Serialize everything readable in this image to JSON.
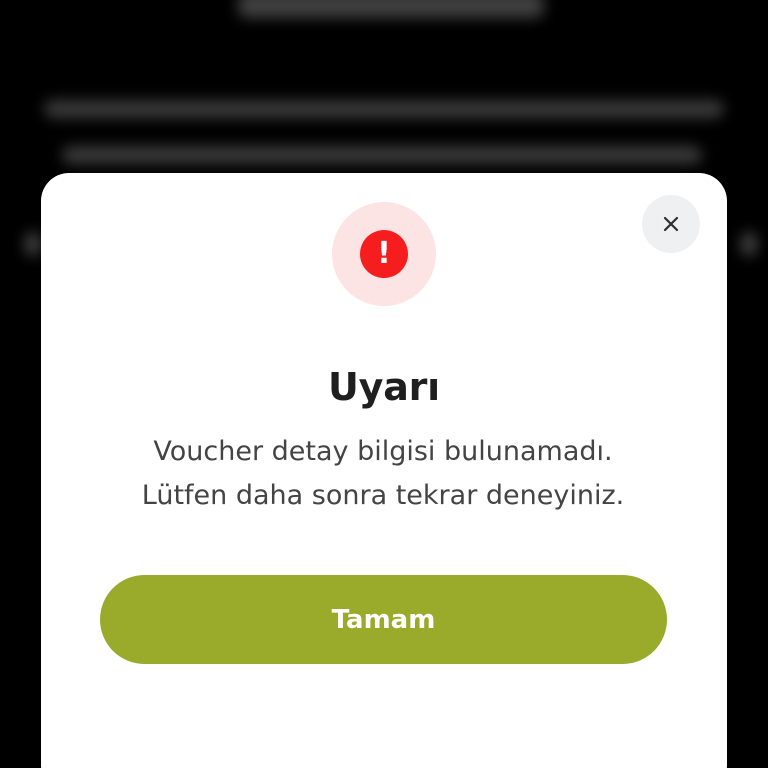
{
  "theme": {
    "accent": "#9AAA2A",
    "alert_red": "#F51D1D",
    "alert_halo": "#FDE4E4",
    "background": "#000000",
    "modal_bg": "#FFFFFF"
  },
  "dialog": {
    "icon": "alert-icon",
    "icon_glyph": "!",
    "close_icon": "close-icon",
    "title": "Uyarı",
    "message": "Voucher detay bilgisi bulunamadı. Lütfen daha sonra tekrar deneyiniz.",
    "primary_button_label": "Tamam"
  }
}
